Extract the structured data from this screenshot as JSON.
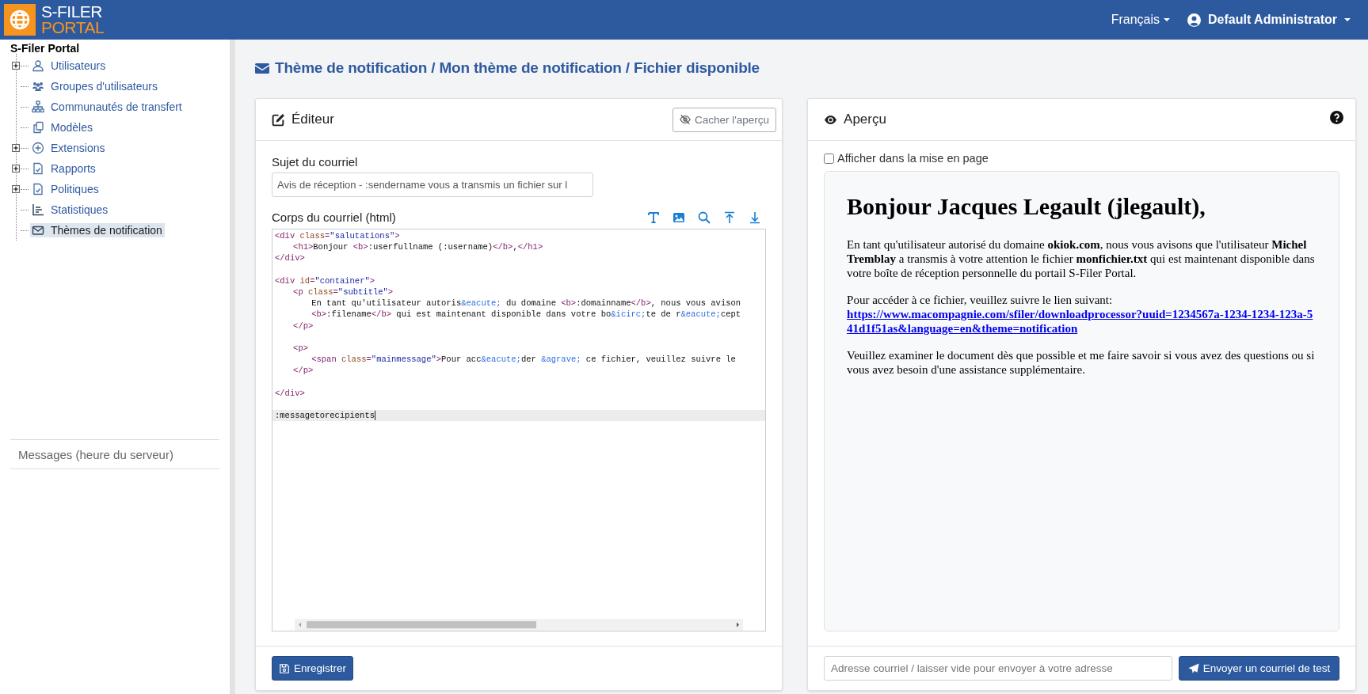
{
  "header": {
    "logo_top": "S-FILER",
    "logo_bottom": "PORTAL",
    "language": "Français",
    "user": "Default Administrator"
  },
  "sidebar": {
    "root": "S-Filer Portal",
    "items": [
      {
        "label": "Utilisateurs",
        "expandable": true,
        "selected": false
      },
      {
        "label": "Groupes d'utilisateurs",
        "expandable": false,
        "selected": false
      },
      {
        "label": "Communautés de transfert",
        "expandable": false,
        "selected": false
      },
      {
        "label": "Modèles",
        "expandable": false,
        "selected": false
      },
      {
        "label": "Extensions",
        "expandable": true,
        "selected": false
      },
      {
        "label": "Rapports",
        "expandable": true,
        "selected": false
      },
      {
        "label": "Politiques",
        "expandable": true,
        "selected": false
      },
      {
        "label": "Statistiques",
        "expandable": false,
        "selected": false
      },
      {
        "label": "Thèmes de notification",
        "expandable": false,
        "selected": true
      }
    ],
    "messages": "Messages (heure du serveur)"
  },
  "breadcrumb": "Thème de notification / Mon thème de notification / Fichier disponible",
  "editor": {
    "title": "Éditeur",
    "hide_button": "Cacher l'aperçu",
    "subject_label": "Sujet du courriel",
    "subject_value": "Avis de réception - :sendername vous a transmis un fichier sur l",
    "body_label": "Corps du courriel (html)",
    "code": [
      {
        "active": false,
        "tokens": [
          {
            "kind": "tag",
            "text": "<div"
          },
          {
            "kind": "attr",
            "text": " class"
          },
          {
            "kind": "tag",
            "text": "="
          },
          {
            "kind": "str",
            "text": "\"salutations\""
          },
          {
            "kind": "tag",
            "text": ">"
          }
        ],
        "children": [
          {
            "active": false,
            "tokens": [
              {
                "kind": "tag",
                "text": "<h1>"
              },
              {
                "kind": "text",
                "text": "Bonjour "
              },
              {
                "kind": "tag",
                "text": "<b>"
              },
              {
                "kind": "text",
                "text": ":userfullname (:username)"
              },
              {
                "kind": "tag",
                "text": "</b>"
              },
              {
                "kind": "text",
                "text": ","
              },
              {
                "kind": "tag",
                "text": "</h1>"
              }
            ]
          }
        ]
      },
      {
        "active": false,
        "tokens": [
          {
            "kind": "tag",
            "text": "</div>"
          }
        ]
      },
      {
        "active": false
      },
      {
        "active": false,
        "tokens": [
          {
            "kind": "tag",
            "text": "<div"
          },
          {
            "kind": "attr",
            "text": " id"
          },
          {
            "kind": "tag",
            "text": "="
          },
          {
            "kind": "str",
            "text": "\"container\""
          },
          {
            "kind": "tag",
            "text": ">"
          }
        ],
        "children": [
          {
            "active": false,
            "tokens": [
              {
                "kind": "tag",
                "text": "<p"
              },
              {
                "kind": "attr",
                "text": " class"
              },
              {
                "kind": "tag",
                "text": "="
              },
              {
                "kind": "str",
                "text": "\"subtitle\""
              },
              {
                "kind": "tag",
                "text": ">"
              }
            ],
            "children": [
              {
                "active": false,
                "tokens": [
                  {
                    "kind": "text",
                    "text": "En tant qu'utilisateur autoris"
                  },
                  {
                    "kind": "entity",
                    "text": "&eacute;"
                  },
                  {
                    "kind": "text",
                    "text": " du domaine "
                  },
                  {
                    "kind": "tag",
                    "text": "<b>"
                  },
                  {
                    "kind": "text",
                    "text": ":domainname"
                  },
                  {
                    "kind": "tag",
                    "text": "</b>"
                  },
                  {
                    "kind": "text",
                    "text": ", nous vous avison"
                  }
                ]
              },
              {
                "active": false,
                "tokens": [
                  {
                    "kind": "tag",
                    "text": "<b>"
                  },
                  {
                    "kind": "text",
                    "text": ":filename"
                  },
                  {
                    "kind": "tag",
                    "text": "</b>"
                  },
                  {
                    "kind": "text",
                    "text": " qui est maintenant disponible dans votre bo"
                  },
                  {
                    "kind": "entity",
                    "text": "&icirc;"
                  },
                  {
                    "kind": "text",
                    "text": "te de r"
                  },
                  {
                    "kind": "entity",
                    "text": "&eacute;"
                  },
                  {
                    "kind": "text",
                    "text": "cept"
                  }
                ]
              }
            ]
          },
          {
            "active": false,
            "tokens": [
              {
                "kind": "tag",
                "text": "</p>"
              }
            ]
          },
          {
            "active": false
          },
          {
            "active": false,
            "tokens": [
              {
                "kind": "tag",
                "text": "<p>"
              }
            ],
            "children": [
              {
                "active": false,
                "tokens": [
                  {
                    "kind": "tag",
                    "text": "<span"
                  },
                  {
                    "kind": "attr",
                    "text": " class"
                  },
                  {
                    "kind": "tag",
                    "text": "="
                  },
                  {
                    "kind": "str",
                    "text": "\"mainmessage\""
                  },
                  {
                    "kind": "tag",
                    "text": ">"
                  },
                  {
                    "kind": "text",
                    "text": "Pour acc"
                  },
                  {
                    "kind": "entity",
                    "text": "&eacute;"
                  },
                  {
                    "kind": "text",
                    "text": "der "
                  },
                  {
                    "kind": "entity",
                    "text": "&agrave;"
                  },
                  {
                    "kind": "text",
                    "text": " ce fichier, veuillez suivre le"
                  }
                ]
              }
            ]
          },
          {
            "active": false,
            "tokens": [
              {
                "kind": "tag",
                "text": "</p>"
              }
            ]
          },
          {
            "active": false
          }
        ]
      },
      {
        "active": false,
        "tokens": [
          {
            "kind": "tag",
            "text": "</div>"
          }
        ]
      },
      {
        "active": false
      },
      {
        "active": true,
        "tokens": [
          {
            "kind": "text",
            "text": ":messagetorecipients"
          }
        ]
      }
    ],
    "save_button": "Enregistrer"
  },
  "preview": {
    "title": "Aperçu",
    "layout_checkbox": {
      "label": "Afficher dans la mise en page",
      "checked": false
    },
    "email": {
      "heading": "Bonjour Jacques Legault (jlegault),",
      "paragraph_1": "En tant qu'utilisateur autorisé du domaine **okiok.com**, nous vous avisons que l'utilisateur **Michel Tremblay** a transmis à votre attention le fichier **monfichier.txt** qui est maintenant disponible dans votre boîte de réception personnelle du portail S-Filer Portal.",
      "paragraph_2": "Pour accéder à ce fichier, veuillez suivre le lien suivant:",
      "link": "https://www.macompagnie.com/sfiler/downloadprocessor?uuid=1234567a-1234-1234-123a-541d1f51as&language=en&theme=notification",
      "paragraph_3": "Veuillez examiner le document dès que possible et me faire savoir si vous avez des questions ou si vous avez besoin d'une assistance supplémentaire."
    },
    "address_placeholder": "Adresse courriel / laisser vide pour envoyer à votre adresse",
    "send_button": "Envoyer un courriel de test"
  }
}
